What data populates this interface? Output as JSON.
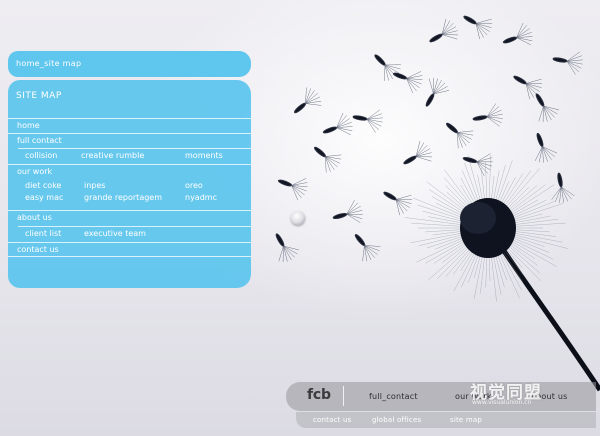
{
  "breadcrumb": {
    "label": "home_site map"
  },
  "sitemap": {
    "title": "SITE MAP",
    "home": "home",
    "full_contact": {
      "label": "full contact",
      "children": [
        "collision",
        "creative rumble",
        "moments"
      ]
    },
    "our_work": {
      "label": "our work",
      "children_row1": [
        "diet coke",
        "inpes",
        "oreo"
      ],
      "children_row2": [
        "easy mac",
        "grande reportagem",
        "nyadmc"
      ]
    },
    "about_us": {
      "label": "about us",
      "children": [
        "client list",
        "executive team"
      ]
    },
    "contact_us": "contact us"
  },
  "footer": {
    "logo": "fcb",
    "primary": [
      "full_contact",
      "our work",
      "about us"
    ],
    "secondary": [
      "contact us",
      "global offices",
      "site map"
    ]
  },
  "watermark": {
    "title": "视觉同盟",
    "url": "www.visualunion.cn"
  },
  "colors": {
    "accent": "#5fc6ee",
    "background": "#e9e8ee",
    "ink": "#1c2230"
  }
}
